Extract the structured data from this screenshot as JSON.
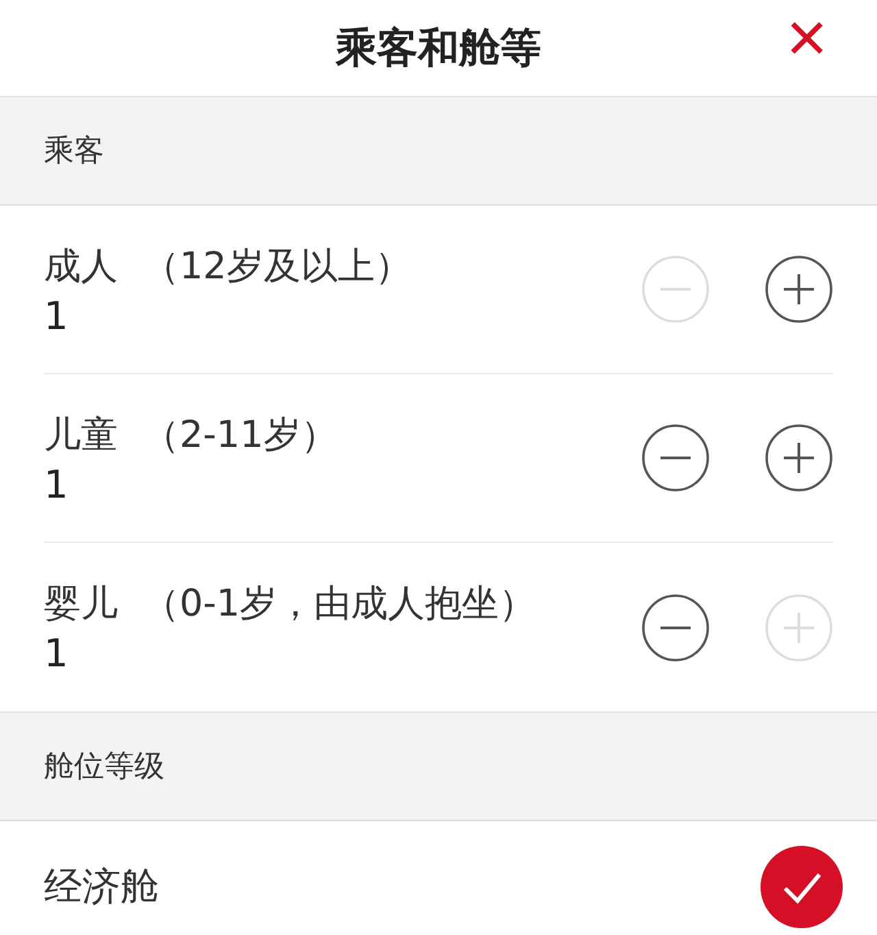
{
  "header": {
    "title": "乘客和舱等",
    "close": "×"
  },
  "passenger_section": {
    "title": "乘客"
  },
  "passengers": [
    {
      "name": "成人",
      "note": "（12岁及以上）",
      "count": "1",
      "minus_disabled": true,
      "plus_disabled": false
    },
    {
      "name": "儿童",
      "note": "（2-11岁）",
      "count": "1",
      "minus_disabled": false,
      "plus_disabled": false
    },
    {
      "name": "婴儿",
      "note": "（0-1岁，由成人抱坐）",
      "count": "1",
      "minus_disabled": false,
      "plus_disabled": true
    }
  ],
  "cabin_section": {
    "title": "舱位等级"
  },
  "cabins": [
    {
      "label": "经济舱",
      "selected": true
    }
  ]
}
